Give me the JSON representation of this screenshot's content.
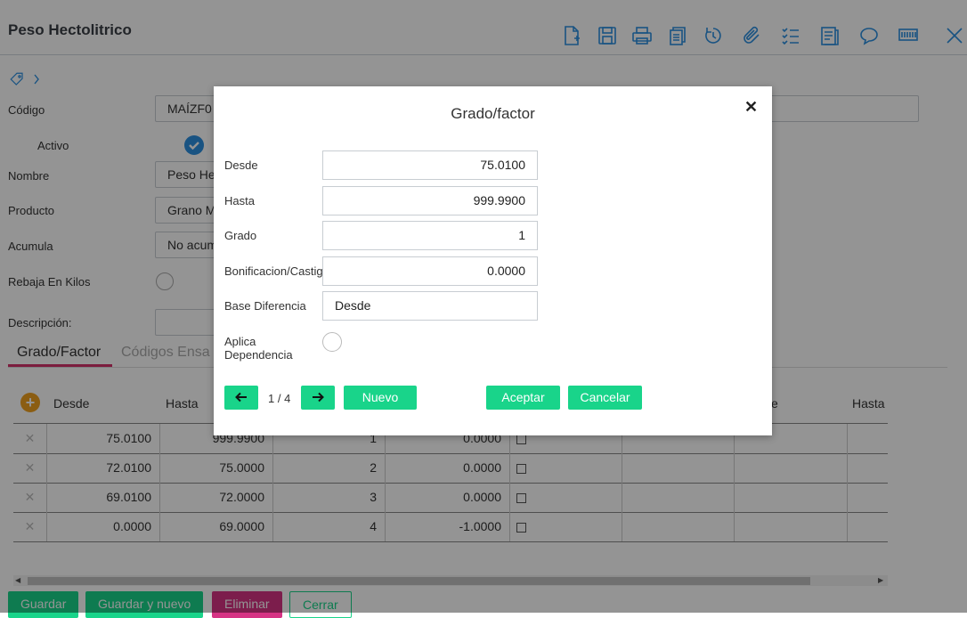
{
  "page": {
    "title": "Peso Hectolitrico"
  },
  "toolbar": {
    "icons": [
      "new-document-icon",
      "save-icon",
      "print-icon",
      "copy-icon",
      "refresh-icon",
      "attachment-icon",
      "checklist-icon",
      "report-icon",
      "comment-icon",
      "barcode-icon",
      "close-icon"
    ]
  },
  "form": {
    "codigo_label": "Código",
    "codigo_value": "MAÍZF0",
    "activo_label": "Activo",
    "nombre_label": "Nombre",
    "nombre_value": "Peso He",
    "producto_label": "Producto",
    "producto_value": "Grano M",
    "acumula_label": "Acumula",
    "acumula_value": "No acum",
    "rebaja_label": "Rebaja En Kilos",
    "descripcion_label": "Descripción:"
  },
  "tabs": [
    {
      "label": "Grado/Factor"
    },
    {
      "label": "Códigos Ensa"
    }
  ],
  "grid": {
    "headers": [
      "Desde",
      "Hasta",
      "e",
      "Hasta"
    ],
    "rows": [
      [
        "75.0100",
        "999.9900",
        "1",
        "0.0000"
      ],
      [
        "72.0100",
        "75.0000",
        "2",
        "0.0000"
      ],
      [
        "69.0100",
        "72.0000",
        "3",
        "0.0000"
      ],
      [
        "0.0000",
        "69.0000",
        "4",
        "-1.0000"
      ]
    ]
  },
  "buttons": {
    "guardar": "Guardar",
    "guardar_nuevo": "Guardar y nuevo",
    "eliminar": "Eliminar",
    "cerrar": "Cerrar"
  },
  "modal": {
    "title": "Grado/factor",
    "desde_label": "Desde",
    "desde_value": "75.0100",
    "hasta_label": "Hasta",
    "hasta_value": "999.9900",
    "grado_label": "Grado",
    "grado_value": "1",
    "bonif_label": "Bonificacion/Castigo",
    "bonif_value": "0.0000",
    "base_label": "Base Diferencia",
    "base_value": "Desde",
    "aplica_label": "Aplica Dependencia",
    "pager": "1 / 4",
    "nuevo": "Nuevo",
    "aceptar": "Aceptar",
    "cancelar": "Cancelar"
  },
  "colors": {
    "accent_green": "#19d48a",
    "accent_blue": "#2c8fe0",
    "tab_underline": "#d6336c",
    "eliminar": "#d63384"
  }
}
